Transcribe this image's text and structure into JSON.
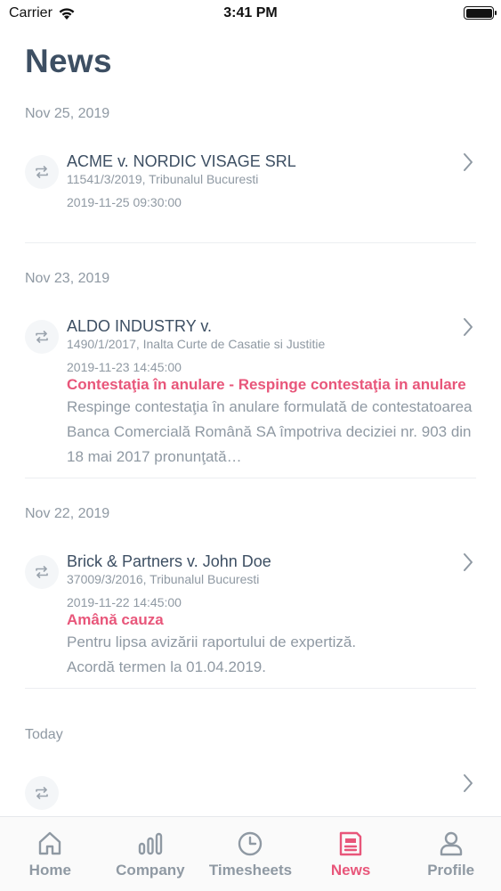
{
  "status_bar": {
    "carrier": "Carrier",
    "time": "3:41 PM"
  },
  "page": {
    "title": "News"
  },
  "sections": [
    {
      "date": "Nov 25, 2019",
      "items": [
        {
          "title": "ACME v. NORDIC VISAGE SRL",
          "subtitle": "11541/3/2019, Tribunalul Bucuresti",
          "time": "2019-11-25 09:30:00",
          "status": "",
          "description": ""
        }
      ]
    },
    {
      "date": "Nov 23, 2019",
      "items": [
        {
          "title": "ALDO INDUSTRY v.",
          "subtitle": "1490/1/2017, Inalta Curte de Casatie si Justitie",
          "time": "2019-11-23 14:45:00",
          "status": "Contestaţia în anulare - Respinge contestaţia in anulare",
          "description": "Respinge contestaţia în anulare formulată de contestatoarea Banca Comercială Română SA împotriva deciziei nr. 903 din 18 mai 2017 pronunţată…"
        }
      ]
    },
    {
      "date": "Nov 22, 2019",
      "items": [
        {
          "title": "Brick & Partners v. John Doe",
          "subtitle": "37009/3/2016, Tribunalul Bucuresti",
          "time": "2019-11-22 14:45:00",
          "status": "Amână cauza",
          "description": "Pentru lipsa avizării raportului de expertiză. Acordă termen la 01.04.2019."
        }
      ]
    },
    {
      "date": "Today",
      "items": [
        {
          "title": "",
          "subtitle": "",
          "time": "",
          "status": "",
          "description": ""
        }
      ]
    }
  ],
  "tab_bar": {
    "tabs": [
      {
        "label": "Home",
        "icon": "home-icon"
      },
      {
        "label": "Company",
        "icon": "bar-chart-icon"
      },
      {
        "label": "Timesheets",
        "icon": "clock-icon"
      },
      {
        "label": "News",
        "icon": "newspaper-icon",
        "active": true
      },
      {
        "label": "Profile",
        "icon": "user-icon"
      }
    ]
  },
  "colors": {
    "accent": "#e8567a",
    "text": "#3d4f63",
    "muted": "#8f99a3"
  }
}
